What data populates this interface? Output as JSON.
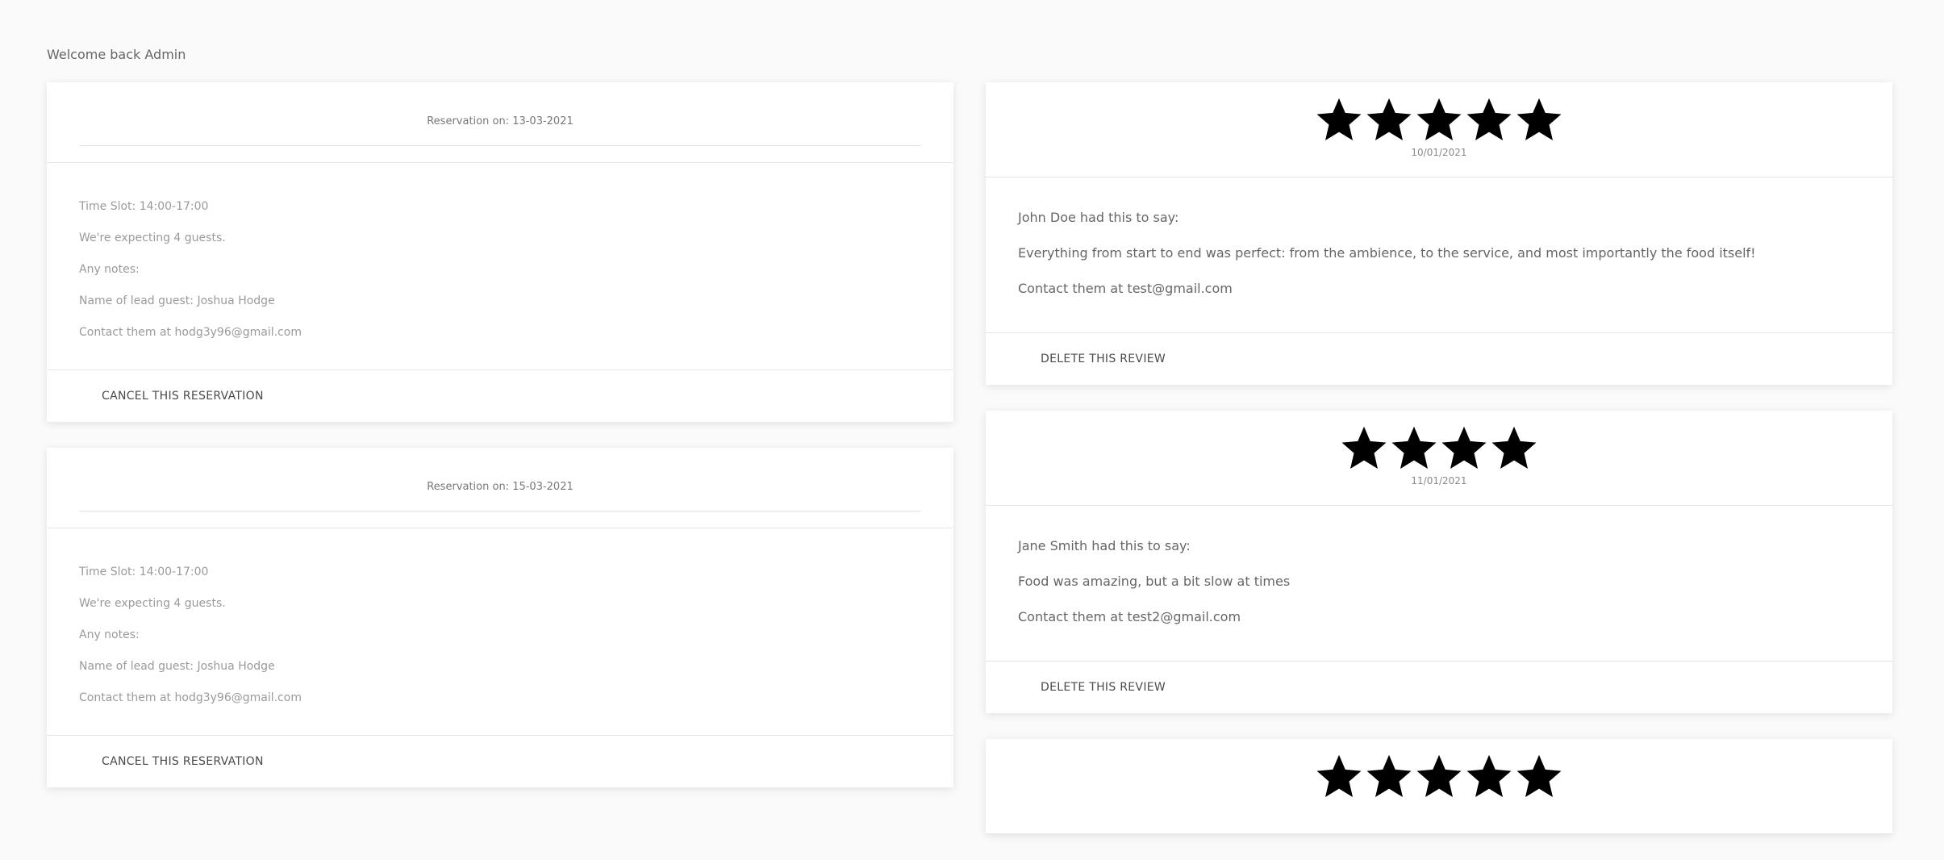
{
  "welcome": "Welcome back Admin",
  "reservations": [
    {
      "title": "Reservation on: 13-03-2021",
      "time_slot": "Time Slot: 14:00-17:00",
      "guests": "We're expecting 4 guests.",
      "notes": "Any notes:",
      "lead": "Name of lead guest: Joshua Hodge",
      "contact": "Contact them at hodg3y96@gmail.com",
      "action": "CANCEL THIS RESERVATION"
    },
    {
      "title": "Reservation on: 15-03-2021",
      "time_slot": "Time Slot: 14:00-17:00",
      "guests": "We're expecting 4 guests.",
      "notes": "Any notes:",
      "lead": "Name of lead guest: Joshua Hodge",
      "contact": "Contact them at hodg3y96@gmail.com",
      "action": "CANCEL THIS RESERVATION"
    }
  ],
  "reviews": [
    {
      "rating": 5,
      "date": "10/01/2021",
      "author_line": "John Doe had this to say:",
      "text": "Everything from start to end was perfect: from the ambience, to the service, and most importantly the food itself!",
      "contact": "Contact them at test@gmail.com",
      "action": "DELETE THIS REVIEW"
    },
    {
      "rating": 4,
      "date": "11/01/2021",
      "author_line": "Jane Smith had this to say:",
      "text": "Food was amazing, but a bit slow at times",
      "contact": "Contact them at test2@gmail.com",
      "action": "DELETE THIS REVIEW"
    },
    {
      "rating": 5,
      "date": "",
      "author_line": "",
      "text": "",
      "contact": "",
      "action": ""
    }
  ],
  "icons": {
    "star": "star-icon"
  },
  "colors": {
    "star": "#000000",
    "card_bg": "#ffffff",
    "page_bg": "#fafafa"
  }
}
